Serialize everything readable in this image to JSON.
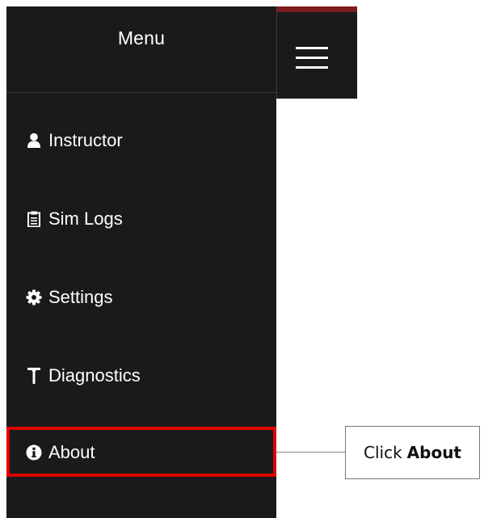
{
  "menu": {
    "title": "Menu",
    "items": [
      {
        "label": "Instructor",
        "icon": "user-icon"
      },
      {
        "label": "Sim Logs",
        "icon": "clipboard-icon"
      },
      {
        "label": "Settings",
        "icon": "gear-icon"
      },
      {
        "label": "Diagnostics",
        "icon": "hammer-icon"
      },
      {
        "label": "About",
        "icon": "info-icon"
      }
    ]
  },
  "header": {
    "menu_button_icon": "hamburger-icon"
  },
  "callout": {
    "prefix": "Click",
    "emphasis": "About"
  },
  "colors": {
    "drawer_bg": "#1a1a1a",
    "text": "#ffffff",
    "highlight": "#e00000",
    "accent_bar": "#7a1c1c"
  }
}
